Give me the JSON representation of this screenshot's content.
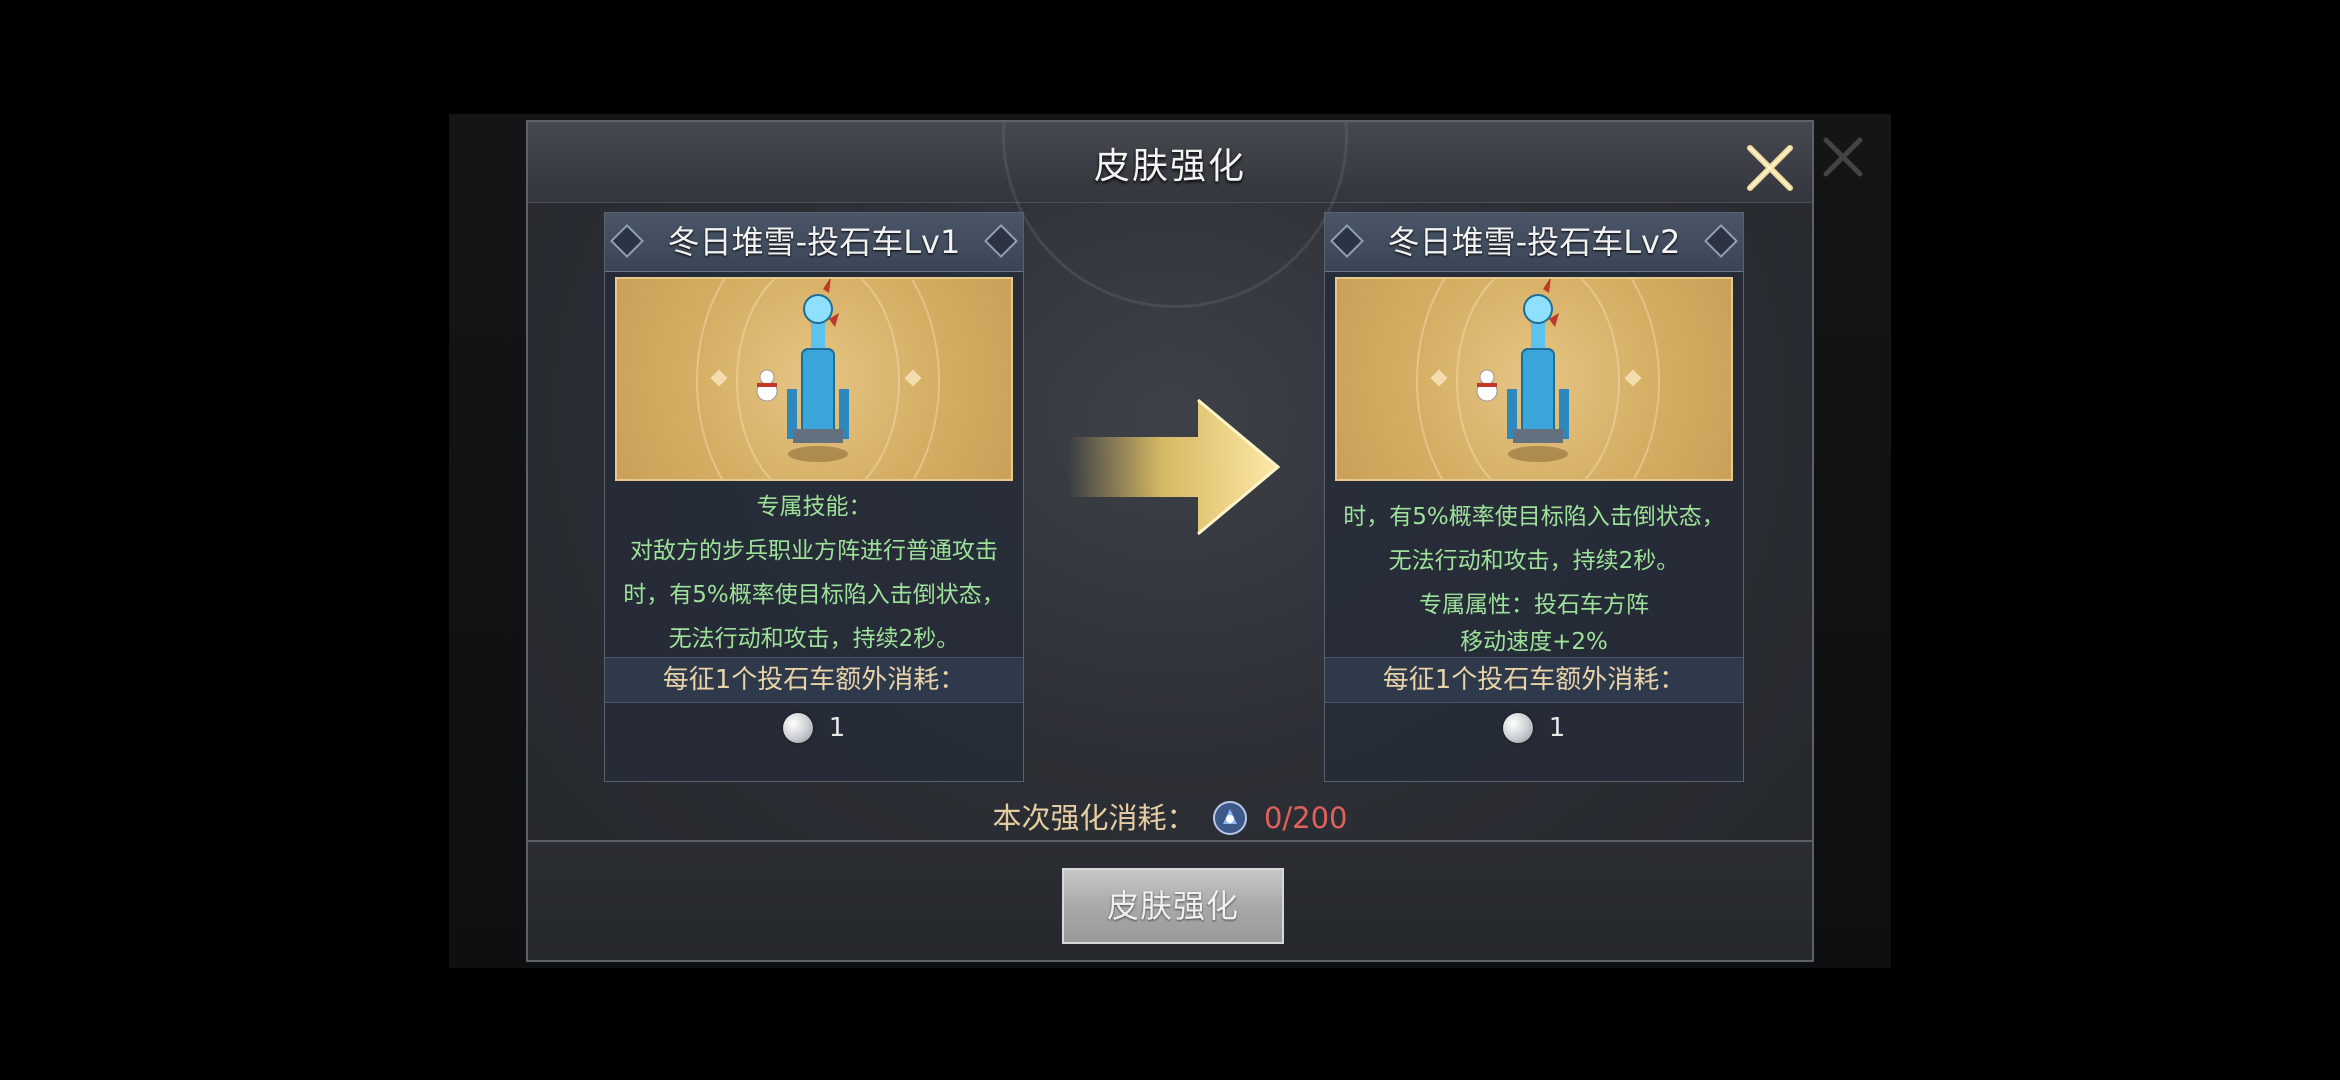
{
  "dialog": {
    "title": "皮肤强化",
    "close_icon": "close-icon"
  },
  "panels": [
    {
      "name": "冬日堆雪-投石车Lv1",
      "skill_title": "专属技能：",
      "lines": [
        "对敌方的步兵职业方阵进行普通攻击",
        "时，有5%概率使目标陷入击倒状态，",
        "无法行动和攻击，持续2秒。"
      ],
      "cost_label": "每征1个投石车额外消耗：",
      "cost_value": "1"
    },
    {
      "name": "冬日堆雪-投石车Lv2",
      "lines": [
        "时，有5%概率使目标陷入击倒状态，",
        "无法行动和攻击，持续2秒。",
        "专属属性：投石车方阵",
        "移动速度+2%"
      ],
      "cost_label": "每征1个投石车额外消耗：",
      "cost_value": "1"
    }
  ],
  "consume": {
    "label": "本次强化消耗：",
    "count": "0/200"
  },
  "button": {
    "label": "皮肤强化"
  },
  "colors": {
    "skill_text": "#9ee29a",
    "cost_text": "#e8d2a6",
    "insufficient": "#e0605a",
    "arrow_gold": "#f2cf6a"
  }
}
